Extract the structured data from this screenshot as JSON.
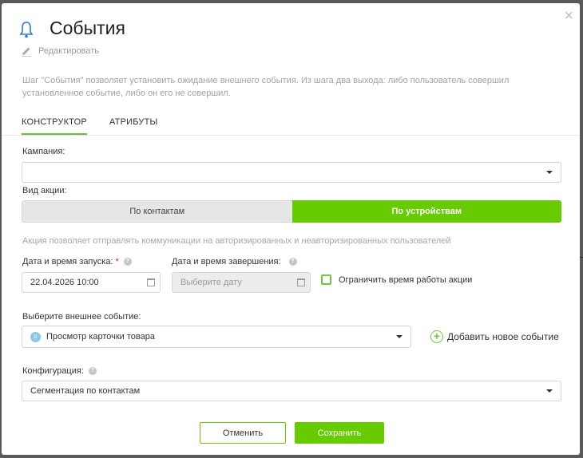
{
  "modal": {
    "title": "События",
    "edit_label": "Редактировать",
    "description": "Шаг \"События\" позволяет установить ожидание внешнего события. Из шага два выхода: либо пользователь совершил установленное событие, либо он его не совершил.",
    "close_glyph": "×"
  },
  "tabs": [
    {
      "label": "КОНСТРУКТОР",
      "active": true
    },
    {
      "label": "АТРИБУТЫ",
      "active": false
    }
  ],
  "form": {
    "campaign_label": "Кампания:",
    "campaign_value": "",
    "action_type_label": "Вид акции:",
    "action_type_options": [
      "По контактам",
      "По устройствам"
    ],
    "action_type_selected": "По устройствам",
    "action_hint": "Акция позволяет отправлять коммуникации на авторизированных и неавторизированных пользователей",
    "start_label": "Дата и время запуска:",
    "start_required_mark": "*",
    "start_value": "22.04.2026 10:00",
    "end_label": "Дата и время завершения:",
    "end_placeholder": "Выберите дату",
    "limit_label": "Ограничить время работы акции",
    "limit_checked": false,
    "event_label": "Выберите внешнее событие:",
    "event_badge": "0",
    "event_value": "Просмотр карточки товара",
    "add_event_label": "Добавить новое событие",
    "config_label": "Конфигурация:",
    "config_value": "Сегментация по контактам",
    "help_glyph": "?"
  },
  "footer": {
    "cancel_label": "Отменить",
    "save_label": "Сохранить"
  },
  "colors": {
    "accent": "#66cc00",
    "bell": "#2c7bd6",
    "required": "#e02020"
  }
}
